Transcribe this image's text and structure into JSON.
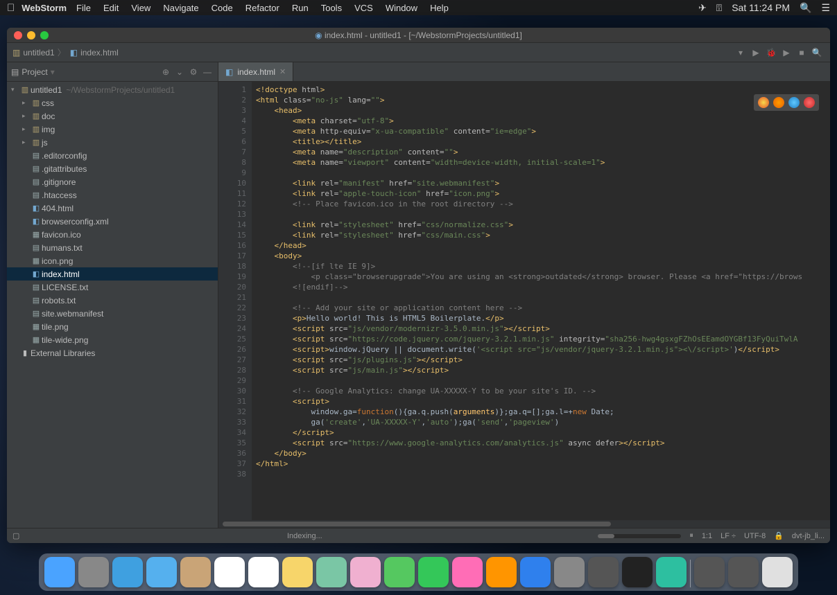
{
  "menubar": {
    "app_name": "WebStorm",
    "items": [
      "File",
      "Edit",
      "View",
      "Navigate",
      "Code",
      "Refactor",
      "Run",
      "Tools",
      "VCS",
      "Window",
      "Help"
    ],
    "clock": "Sat 11:24 PM"
  },
  "window_title": "index.html - untitled1 - [~/WebstormProjects/untitled1]",
  "breadcrumb": {
    "project": "untitled1",
    "file": "index.html"
  },
  "project_panel": {
    "title": "Project",
    "root": "untitled1",
    "root_hint": "~/WebstormProjects/untitled1",
    "folders": [
      "css",
      "doc",
      "img",
      "js"
    ],
    "files": [
      {
        "name": ".editorconfig",
        "type": "txt"
      },
      {
        "name": ".gitattributes",
        "type": "txt"
      },
      {
        "name": ".gitignore",
        "type": "txt"
      },
      {
        "name": ".htaccess",
        "type": "txt"
      },
      {
        "name": "404.html",
        "type": "html"
      },
      {
        "name": "browserconfig.xml",
        "type": "xml"
      },
      {
        "name": "favicon.ico",
        "type": "img"
      },
      {
        "name": "humans.txt",
        "type": "txt"
      },
      {
        "name": "icon.png",
        "type": "img"
      },
      {
        "name": "index.html",
        "type": "html",
        "selected": true
      },
      {
        "name": "LICENSE.txt",
        "type": "txt"
      },
      {
        "name": "robots.txt",
        "type": "txt"
      },
      {
        "name": "site.webmanifest",
        "type": "txt"
      },
      {
        "name": "tile.png",
        "type": "img"
      },
      {
        "name": "tile-wide.png",
        "type": "img"
      }
    ],
    "external_lib": "External Libraries"
  },
  "editor": {
    "tab": "index.html",
    "lines": [
      [
        {
          "t": "tag",
          "s": "<!doctype "
        },
        {
          "t": "attr",
          "s": "html"
        },
        {
          "t": "tag",
          "s": ">"
        }
      ],
      [
        {
          "t": "tag",
          "s": "<html "
        },
        {
          "t": "attr",
          "s": "class="
        },
        {
          "t": "str",
          "s": "\"no-js\""
        },
        {
          "t": "attr",
          "s": " lang="
        },
        {
          "t": "str",
          "s": "\"\""
        },
        {
          "t": "tag",
          "s": ">"
        }
      ],
      [
        {
          "t": "pad",
          "s": "    "
        },
        {
          "t": "tag",
          "s": "<head>"
        }
      ],
      [
        {
          "t": "pad",
          "s": "        "
        },
        {
          "t": "tag",
          "s": "<meta "
        },
        {
          "t": "attr",
          "s": "charset="
        },
        {
          "t": "str",
          "s": "\"utf-8\""
        },
        {
          "t": "tag",
          "s": ">"
        }
      ],
      [
        {
          "t": "pad",
          "s": "        "
        },
        {
          "t": "tag",
          "s": "<meta "
        },
        {
          "t": "attr",
          "s": "http-equiv="
        },
        {
          "t": "str",
          "s": "\"x-ua-compatible\""
        },
        {
          "t": "attr",
          "s": " content="
        },
        {
          "t": "str",
          "s": "\"ie=edge\""
        },
        {
          "t": "tag",
          "s": ">"
        }
      ],
      [
        {
          "t": "pad",
          "s": "        "
        },
        {
          "t": "tag",
          "s": "<title></title>"
        }
      ],
      [
        {
          "t": "pad",
          "s": "        "
        },
        {
          "t": "tag",
          "s": "<meta "
        },
        {
          "t": "attr",
          "s": "name="
        },
        {
          "t": "str",
          "s": "\"description\""
        },
        {
          "t": "attr",
          "s": " content="
        },
        {
          "t": "str",
          "s": "\"\""
        },
        {
          "t": "tag",
          "s": ">"
        }
      ],
      [
        {
          "t": "pad",
          "s": "        "
        },
        {
          "t": "tag",
          "s": "<meta "
        },
        {
          "t": "attr",
          "s": "name="
        },
        {
          "t": "str",
          "s": "\"viewport\""
        },
        {
          "t": "attr",
          "s": " content="
        },
        {
          "t": "str",
          "s": "\"width=device-width, initial-scale=1\""
        },
        {
          "t": "tag",
          "s": ">"
        }
      ],
      [],
      [
        {
          "t": "pad",
          "s": "        "
        },
        {
          "t": "tag",
          "s": "<link "
        },
        {
          "t": "attr",
          "s": "rel="
        },
        {
          "t": "str",
          "s": "\"manifest\""
        },
        {
          "t": "attr",
          "s": " href="
        },
        {
          "t": "str",
          "s": "\"site.webmanifest\""
        },
        {
          "t": "tag",
          "s": ">"
        }
      ],
      [
        {
          "t": "pad",
          "s": "        "
        },
        {
          "t": "tag",
          "s": "<link "
        },
        {
          "t": "attr",
          "s": "rel="
        },
        {
          "t": "str",
          "s": "\"apple-touch-icon\""
        },
        {
          "t": "attr",
          "s": " href="
        },
        {
          "t": "str",
          "s": "\"icon.png\""
        },
        {
          "t": "tag",
          "s": ">"
        }
      ],
      [
        {
          "t": "pad",
          "s": "        "
        },
        {
          "t": "cmt",
          "s": "<!-- Place favicon.ico in the root directory -->"
        }
      ],
      [],
      [
        {
          "t": "pad",
          "s": "        "
        },
        {
          "t": "tag",
          "s": "<link "
        },
        {
          "t": "attr",
          "s": "rel="
        },
        {
          "t": "str",
          "s": "\"stylesheet\""
        },
        {
          "t": "attr",
          "s": " href="
        },
        {
          "t": "str",
          "s": "\"css/normalize.css\""
        },
        {
          "t": "tag",
          "s": ">"
        }
      ],
      [
        {
          "t": "pad",
          "s": "        "
        },
        {
          "t": "tag",
          "s": "<link "
        },
        {
          "t": "attr",
          "s": "rel="
        },
        {
          "t": "str",
          "s": "\"stylesheet\""
        },
        {
          "t": "attr",
          "s": " href="
        },
        {
          "t": "str",
          "s": "\"css/main.css\""
        },
        {
          "t": "tag",
          "s": ">"
        }
      ],
      [
        {
          "t": "pad",
          "s": "    "
        },
        {
          "t": "tag",
          "s": "</head>"
        }
      ],
      [
        {
          "t": "pad",
          "s": "    "
        },
        {
          "t": "tag",
          "s": "<body>"
        }
      ],
      [
        {
          "t": "pad",
          "s": "        "
        },
        {
          "t": "cmt",
          "s": "<!--[if lte IE 9]>"
        }
      ],
      [
        {
          "t": "pad",
          "s": "            "
        },
        {
          "t": "cmt",
          "s": "<p class=\"browserupgrade\">You are using an <strong>outdated</strong> browser. Please <a href=\"https://brows"
        }
      ],
      [
        {
          "t": "pad",
          "s": "        "
        },
        {
          "t": "cmt",
          "s": "<![endif]-->"
        }
      ],
      [],
      [
        {
          "t": "pad",
          "s": "        "
        },
        {
          "t": "cmt",
          "s": "<!-- Add your site or application content here -->"
        }
      ],
      [
        {
          "t": "pad",
          "s": "        "
        },
        {
          "t": "tag",
          "s": "<p>"
        },
        {
          "t": "txt",
          "s": "Hello world! This is HTML5 Boilerplate."
        },
        {
          "t": "tag",
          "s": "</p>"
        }
      ],
      [
        {
          "t": "pad",
          "s": "        "
        },
        {
          "t": "tag",
          "s": "<script "
        },
        {
          "t": "attr",
          "s": "src="
        },
        {
          "t": "str",
          "s": "\"js/vendor/modernizr-3.5.0.min.js\""
        },
        {
          "t": "tag",
          "s": "></script>"
        }
      ],
      [
        {
          "t": "pad",
          "s": "        "
        },
        {
          "t": "tag",
          "s": "<script "
        },
        {
          "t": "attr",
          "s": "src="
        },
        {
          "t": "str",
          "s": "\"https://code.jquery.com/jquery-3.2.1.min.js\""
        },
        {
          "t": "attr",
          "s": " integrity="
        },
        {
          "t": "str",
          "s": "\"sha256-hwg4gsxgFZhOsEEamdOYGBf13FyQuiTwlA"
        }
      ],
      [
        {
          "t": "pad",
          "s": "        "
        },
        {
          "t": "tag",
          "s": "<script>"
        },
        {
          "t": "txt",
          "s": "window.jQuery || document.write("
        },
        {
          "t": "str",
          "s": "'<script src=\"js/vendor/jquery-3.2.1.min.js\"><\\/script>'"
        },
        {
          "t": "txt",
          "s": ")"
        },
        {
          "t": "tag",
          "s": "</script>"
        }
      ],
      [
        {
          "t": "pad",
          "s": "        "
        },
        {
          "t": "tag",
          "s": "<script "
        },
        {
          "t": "attr",
          "s": "src="
        },
        {
          "t": "str",
          "s": "\"js/plugins.js\""
        },
        {
          "t": "tag",
          "s": "></script>"
        }
      ],
      [
        {
          "t": "pad",
          "s": "        "
        },
        {
          "t": "tag",
          "s": "<script "
        },
        {
          "t": "attr",
          "s": "src="
        },
        {
          "t": "str",
          "s": "\"js/main.js\""
        },
        {
          "t": "tag",
          "s": "></script>"
        }
      ],
      [],
      [
        {
          "t": "pad",
          "s": "        "
        },
        {
          "t": "cmt",
          "s": "<!-- Google Analytics: change UA-XXXXX-Y to be your site's ID. -->"
        }
      ],
      [
        {
          "t": "pad",
          "s": "        "
        },
        {
          "t": "tag",
          "s": "<script>"
        }
      ],
      [
        {
          "t": "pad",
          "s": "            "
        },
        {
          "t": "txt",
          "s": "window.ga="
        },
        {
          "t": "kw",
          "s": "function"
        },
        {
          "t": "txt",
          "s": "(){ga.q.push("
        },
        {
          "t": "fn",
          "s": "arguments"
        },
        {
          "t": "txt",
          "s": ")};ga.q=[];ga.l=+"
        },
        {
          "t": "kw",
          "s": "new "
        },
        {
          "t": "txt",
          "s": "Date;"
        }
      ],
      [
        {
          "t": "pad",
          "s": "            "
        },
        {
          "t": "txt",
          "s": "ga("
        },
        {
          "t": "str",
          "s": "'create'"
        },
        {
          "t": "txt",
          "s": ","
        },
        {
          "t": "str",
          "s": "'UA-XXXXX-Y'"
        },
        {
          "t": "txt",
          "s": ","
        },
        {
          "t": "str",
          "s": "'auto'"
        },
        {
          "t": "txt",
          "s": ");ga("
        },
        {
          "t": "str",
          "s": "'send'"
        },
        {
          "t": "txt",
          "s": ","
        },
        {
          "t": "str",
          "s": "'pageview'"
        },
        {
          "t": "txt",
          "s": ")"
        }
      ],
      [
        {
          "t": "pad",
          "s": "        "
        },
        {
          "t": "tag",
          "s": "</script>"
        }
      ],
      [
        {
          "t": "pad",
          "s": "        "
        },
        {
          "t": "tag",
          "s": "<script "
        },
        {
          "t": "attr",
          "s": "src="
        },
        {
          "t": "str",
          "s": "\"https://www.google-analytics.com/analytics.js\""
        },
        {
          "t": "attr",
          "s": " async defer"
        },
        {
          "t": "tag",
          "s": "></script>"
        }
      ],
      [
        {
          "t": "pad",
          "s": "    "
        },
        {
          "t": "tag",
          "s": "</body>"
        }
      ],
      [
        {
          "t": "tag",
          "s": "</html>"
        }
      ],
      []
    ]
  },
  "statusbar": {
    "center": "Indexing...",
    "pos": "1:1",
    "le": "LF",
    "enc": "UTF-8",
    "right_file": "dvt-jb_li..."
  },
  "dock": [
    "finder",
    "launchpad",
    "safari",
    "mail",
    "contacts",
    "calendar",
    "reminders",
    "notes",
    "maps",
    "photos",
    "messages",
    "facetime",
    "music",
    "books",
    "appstore",
    "settings",
    "prefs",
    "terminal",
    "webstorm"
  ]
}
